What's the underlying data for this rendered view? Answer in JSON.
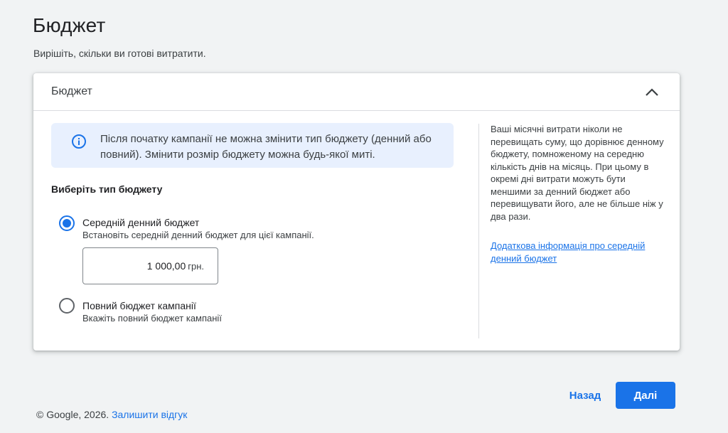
{
  "page": {
    "title": "Бюджет",
    "subtitle": "Вирішіть, скільки ви готові витратити."
  },
  "card": {
    "title": "Бюджет",
    "info": "Після початку кампанії не можна змінити тип бюджету (денний або повний). Змінити розмір бюджету можна будь-якої миті.",
    "section_heading": "Виберіть тип бюджету",
    "options": [
      {
        "label": "Середній денний бюджет",
        "description": "Встановіть середній денний бюджет для цієї кампанії.",
        "selected": true
      },
      {
        "label": "Повний бюджет кампанії",
        "description": "Вкажіть повний бюджет кампанії",
        "selected": false
      }
    ],
    "amount": {
      "value": "1 000,00",
      "unit": "грн."
    },
    "side": {
      "text": "Ваші місячні витрати ніколи не перевищать суму, що дорівнює денному бюджету, помноженому на середню кількість днів на місяць. При цьому в окремі дні витрати можуть бути меншими за денний бюджет або перевищувати його, але не більше ніж у два рази.",
      "link": "Додаткова інформація про середній денний бюджет"
    }
  },
  "footer": {
    "copyright": "© Google, 2026.",
    "feedback_link": "Залишити відгук"
  },
  "actions": {
    "back": "Назад",
    "next": "Далі"
  },
  "icons": {
    "info": "info-icon",
    "collapse": "chevron-up-icon"
  },
  "colors": {
    "accent": "#1a73e8",
    "info_bg": "#e8f0fe"
  }
}
